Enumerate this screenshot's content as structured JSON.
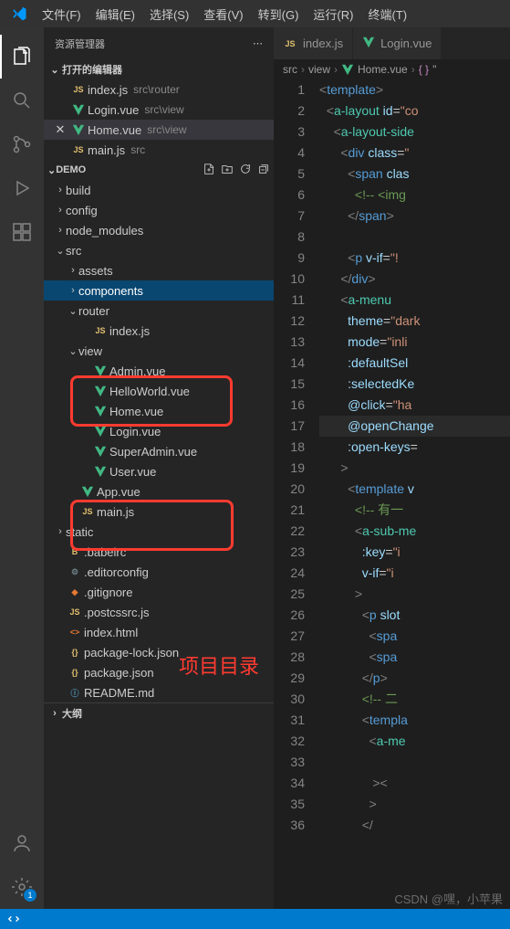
{
  "menubar": {
    "items": [
      "文件(F)",
      "编辑(E)",
      "选择(S)",
      "查看(V)",
      "转到(G)",
      "运行(R)",
      "终端(T)"
    ]
  },
  "sidebar": {
    "title": "资源管理器",
    "open_editors_label": "打开的编辑器",
    "open_editors": [
      {
        "icon": "js",
        "name": "index.js",
        "path": "src\\router"
      },
      {
        "icon": "vue",
        "name": "Login.vue",
        "path": "src\\view"
      },
      {
        "icon": "vue",
        "name": "Home.vue",
        "path": "src\\view",
        "active": true
      },
      {
        "icon": "js",
        "name": "main.js",
        "path": "src"
      }
    ],
    "project_name": "DEMO",
    "outline_label": "大纲",
    "tree": [
      {
        "depth": 0,
        "type": "folder",
        "open": false,
        "name": "build"
      },
      {
        "depth": 0,
        "type": "folder",
        "open": false,
        "name": "config"
      },
      {
        "depth": 0,
        "type": "folder",
        "open": false,
        "name": "node_modules"
      },
      {
        "depth": 0,
        "type": "folder",
        "open": true,
        "name": "src"
      },
      {
        "depth": 1,
        "type": "folder",
        "open": false,
        "name": "assets"
      },
      {
        "depth": 1,
        "type": "folder",
        "open": false,
        "name": "components",
        "selected": true
      },
      {
        "depth": 1,
        "type": "folder",
        "open": true,
        "name": "router"
      },
      {
        "depth": 2,
        "type": "file",
        "icon": "js",
        "name": "index.js"
      },
      {
        "depth": 1,
        "type": "folder",
        "open": true,
        "name": "view"
      },
      {
        "depth": 2,
        "type": "file",
        "icon": "vue",
        "name": "Admin.vue"
      },
      {
        "depth": 2,
        "type": "file",
        "icon": "vue",
        "name": "HelloWorld.vue"
      },
      {
        "depth": 2,
        "type": "file",
        "icon": "vue",
        "name": "Home.vue"
      },
      {
        "depth": 2,
        "type": "file",
        "icon": "vue",
        "name": "Login.vue"
      },
      {
        "depth": 2,
        "type": "file",
        "icon": "vue",
        "name": "SuperAdmin.vue"
      },
      {
        "depth": 2,
        "type": "file",
        "icon": "vue",
        "name": "User.vue"
      },
      {
        "depth": 1,
        "type": "file",
        "icon": "vue",
        "name": "App.vue"
      },
      {
        "depth": 1,
        "type": "file",
        "icon": "js",
        "name": "main.js"
      },
      {
        "depth": 0,
        "type": "folder",
        "open": false,
        "name": "static"
      },
      {
        "depth": 0,
        "type": "file",
        "icon": "babel",
        "name": ".babelrc"
      },
      {
        "depth": 0,
        "type": "file",
        "icon": "editor",
        "name": ".editorconfig"
      },
      {
        "depth": 0,
        "type": "file",
        "icon": "git",
        "name": ".gitignore"
      },
      {
        "depth": 0,
        "type": "file",
        "icon": "js",
        "name": ".postcssrc.js"
      },
      {
        "depth": 0,
        "type": "file",
        "icon": "html",
        "name": "index.html"
      },
      {
        "depth": 0,
        "type": "file",
        "icon": "json",
        "name": "package-lock.json"
      },
      {
        "depth": 0,
        "type": "file",
        "icon": "json",
        "name": "package.json"
      },
      {
        "depth": 0,
        "type": "file",
        "icon": "info",
        "name": "README.md"
      }
    ]
  },
  "tabs": [
    {
      "icon": "js",
      "label": "index.js",
      "active": false
    },
    {
      "icon": "vue",
      "label": "Login.vue",
      "active": false
    }
  ],
  "breadcrumb": {
    "parts": [
      "src",
      "view",
      "Home.vue"
    ],
    "symbol": "\""
  },
  "code_lines": [
    {
      "n": 1,
      "html": "<span class='t-tag'>&lt;</span><span class='t-name'>template</span><span class='t-tag'>&gt;</span>"
    },
    {
      "n": 2,
      "html": "  <span class='t-tag'>&lt;</span><span class='t-comp'>a-layout</span> <span class='t-attr'>id</span>=<span class='t-str'>\"co</span>"
    },
    {
      "n": 3,
      "html": "    <span class='t-tag'>&lt;</span><span class='t-comp'>a-layout-side</span>"
    },
    {
      "n": 4,
      "html": "      <span class='t-tag'>&lt;</span><span class='t-name'>div</span> <span class='t-attr'>class</span>=<span class='t-str'>\"</span>"
    },
    {
      "n": 5,
      "html": "        <span class='t-tag'>&lt;</span><span class='t-name'>span</span> <span class='t-attr'>clas</span>"
    },
    {
      "n": 6,
      "html": "          <span class='t-comment'>&lt;!-- &lt;img</span>"
    },
    {
      "n": 7,
      "html": "        <span class='t-tag'>&lt;/</span><span class='t-name'>span</span><span class='t-tag'>&gt;</span>"
    },
    {
      "n": 8,
      "html": ""
    },
    {
      "n": 9,
      "html": "        <span class='t-tag'>&lt;</span><span class='t-name'>p</span> <span class='t-attr'>v-if</span>=<span class='t-str'>\"!</span>"
    },
    {
      "n": 10,
      "html": "      <span class='t-tag'>&lt;/</span><span class='t-name'>div</span><span class='t-tag'>&gt;</span>"
    },
    {
      "n": 11,
      "html": "      <span class='t-tag'>&lt;</span><span class='t-comp'>a-menu</span>"
    },
    {
      "n": 12,
      "html": "        <span class='t-attr'>theme</span>=<span class='t-str'>\"dark</span>"
    },
    {
      "n": 13,
      "html": "        <span class='t-attr'>mode</span>=<span class='t-str'>\"inli</span>"
    },
    {
      "n": 14,
      "html": "        <span class='t-attr'>:defaultSel</span>"
    },
    {
      "n": 15,
      "html": "        <span class='t-attr'>:selectedKe</span>"
    },
    {
      "n": 16,
      "html": "        <span class='t-attr'>@click</span>=<span class='t-str'>\"ha</span>"
    },
    {
      "n": 17,
      "html": "        <span class='t-attr'>@openChange</span>",
      "current": true
    },
    {
      "n": 18,
      "html": "        <span class='t-attr'>:open-keys</span>="
    },
    {
      "n": 19,
      "html": "      <span class='t-tag'>&gt;</span>"
    },
    {
      "n": 20,
      "html": "        <span class='t-tag'>&lt;</span><span class='t-name'>template</span> <span class='t-attr'>v</span>"
    },
    {
      "n": 21,
      "html": "          <span class='t-comment'>&lt;!-- 有一</span>"
    },
    {
      "n": 22,
      "html": "          <span class='t-tag'>&lt;</span><span class='t-comp'>a-sub-me</span>"
    },
    {
      "n": 23,
      "html": "            <span class='t-attr'>:key</span>=<span class='t-str'>\"i</span>"
    },
    {
      "n": 24,
      "html": "            <span class='t-attr'>v-if</span>=<span class='t-str'>\"i</span>"
    },
    {
      "n": 25,
      "html": "          <span class='t-tag'>&gt;</span>"
    },
    {
      "n": 26,
      "html": "            <span class='t-tag'>&lt;</span><span class='t-name'>p</span> <span class='t-attr'>slot</span>"
    },
    {
      "n": 27,
      "html": "              <span class='t-tag'>&lt;</span><span class='t-name'>spa</span>"
    },
    {
      "n": 28,
      "html": "              <span class='t-tag'>&lt;</span><span class='t-name'>spa</span>"
    },
    {
      "n": 29,
      "html": "            <span class='t-tag'>&lt;/</span><span class='t-name'>p</span><span class='t-tag'>&gt;</span>"
    },
    {
      "n": 30,
      "html": "            <span class='t-comment'>&lt;!-- 二</span>"
    },
    {
      "n": 31,
      "html": "            <span class='t-tag'>&lt;</span><span class='t-name'>templa</span>"
    },
    {
      "n": 32,
      "html": "              <span class='t-tag'>&lt;</span><span class='t-comp'>a-me</span>"
    },
    {
      "n": 33,
      "html": ""
    },
    {
      "n": 34,
      "html": "               <span class='t-tag'>&gt;</span><span class='t-tag'>&lt;</span>"
    },
    {
      "n": 35,
      "html": "              <span class='t-tag'>&gt;</span>"
    },
    {
      "n": 36,
      "html": "            <span class='t-tag'>&lt;/</span>"
    }
  ],
  "annotation": {
    "label": "项目目录"
  },
  "watermark": "CSDN @嘿，小苹果",
  "settings_badge": "1"
}
